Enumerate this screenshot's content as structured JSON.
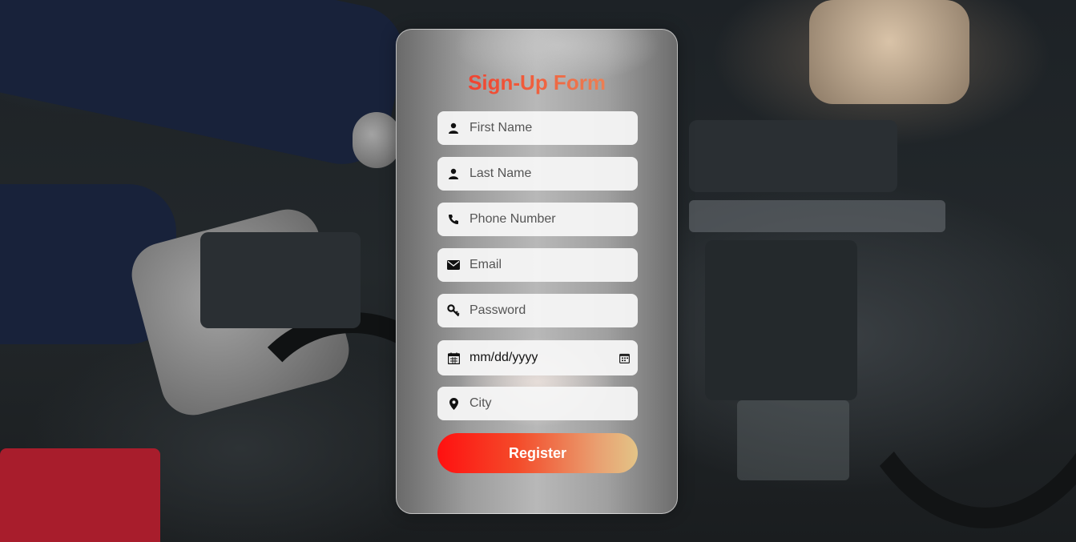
{
  "form": {
    "title": "Sign-Up Form",
    "fields": [
      {
        "name": "first-name",
        "placeholder": "First Name",
        "icon": "user-icon",
        "value": ""
      },
      {
        "name": "last-name",
        "placeholder": "Last Name",
        "icon": "user-icon",
        "value": ""
      },
      {
        "name": "phone",
        "placeholder": "Phone Number",
        "icon": "phone-icon",
        "value": ""
      },
      {
        "name": "email",
        "placeholder": "Email",
        "icon": "envelope-icon",
        "value": ""
      },
      {
        "name": "password",
        "placeholder": "Password",
        "icon": "key-icon",
        "value": ""
      },
      {
        "name": "date",
        "placeholder": "mm/dd/yyyy",
        "icon": "calendar-icon",
        "value": ""
      },
      {
        "name": "city",
        "placeholder": "City",
        "icon": "map-pin-icon",
        "value": ""
      }
    ],
    "submit_label": "Register"
  },
  "colors": {
    "title_gradient": [
      "#f22424",
      "#e9a06a"
    ],
    "button_gradient": [
      "#ff1010",
      "#e3c487"
    ]
  }
}
